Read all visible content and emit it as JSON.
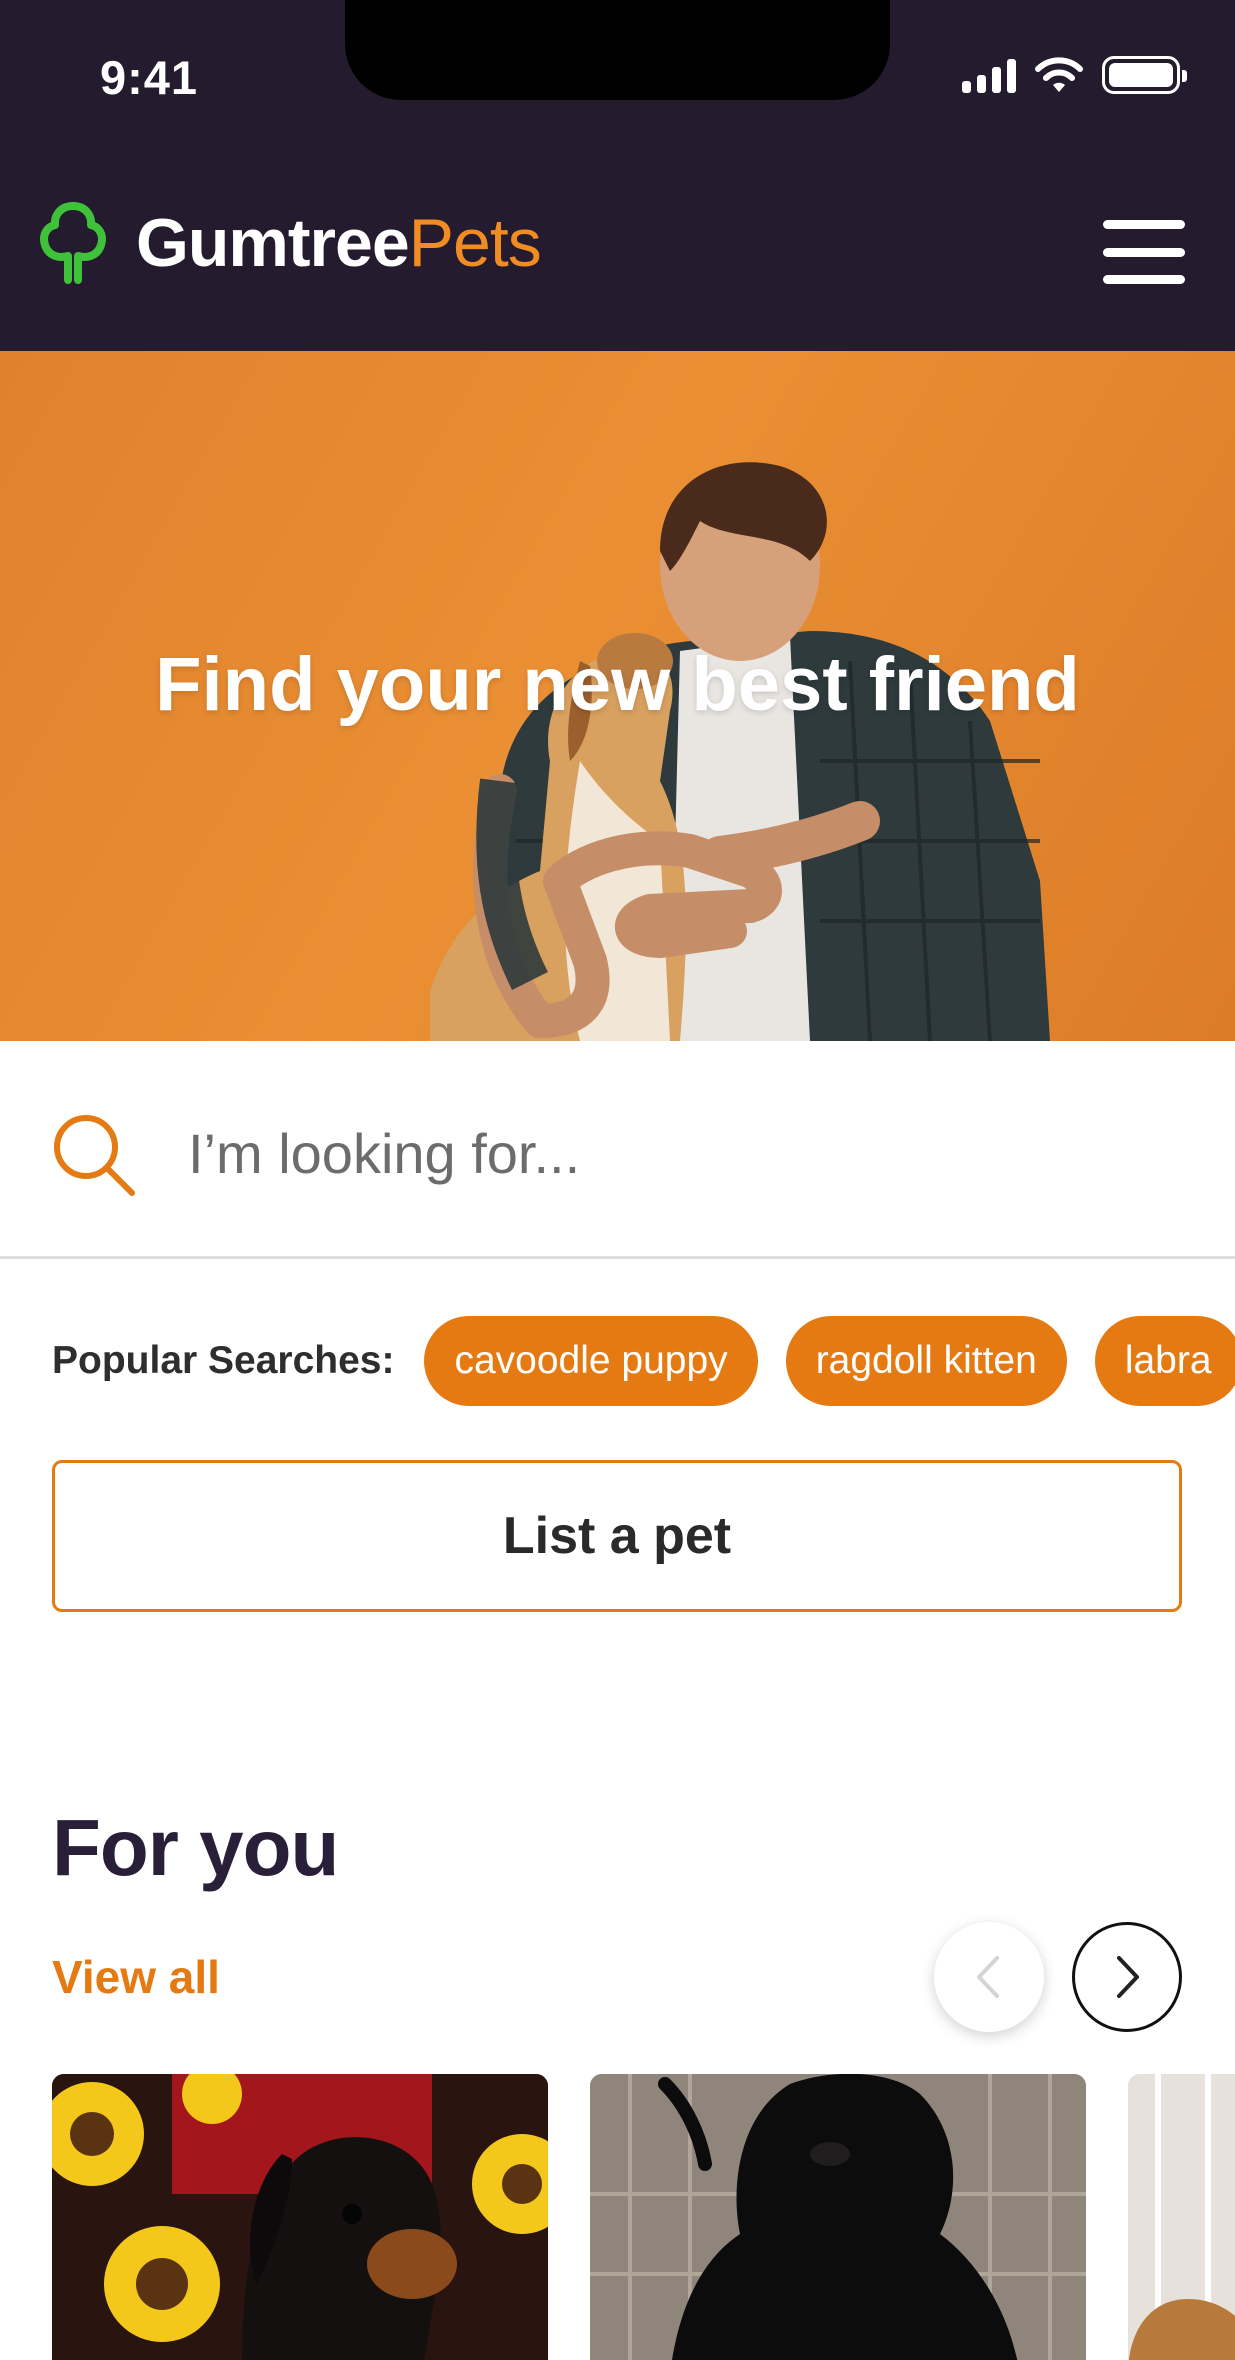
{
  "status_bar": {
    "time": "9:41"
  },
  "header": {
    "logo_primary": "Gumtree",
    "logo_accent": "Pets",
    "logo_icon": "tree-icon",
    "menu_icon": "hamburger-menu-icon"
  },
  "hero": {
    "title": "Find your new best friend",
    "image": "man-hugging-dog-photo"
  },
  "search": {
    "placeholder": "I’m looking for...",
    "value": "",
    "icon": "search-icon"
  },
  "popular_searches": {
    "label": "Popular Searches:",
    "chips": [
      "cavoodle puppy",
      "ragdoll kitten",
      "labra"
    ]
  },
  "list_pet": {
    "label": "List a pet"
  },
  "for_you": {
    "title": "For you",
    "view_all": "View all",
    "prev_icon": "chevron-left-icon",
    "next_icon": "chevron-right-icon",
    "cards": [
      {
        "image": "dachshund-puppy-with-sunflowers-photo"
      },
      {
        "image": "black-labrador-puppy-photo"
      },
      {
        "image": "golden-puppy-photo"
      }
    ]
  },
  "colors": {
    "header_bg": "#251b2f",
    "accent": "#e67a12",
    "logo_green": "#3fc23a",
    "hero_bg": "#e88a31",
    "heading_text": "#2a1f38"
  }
}
